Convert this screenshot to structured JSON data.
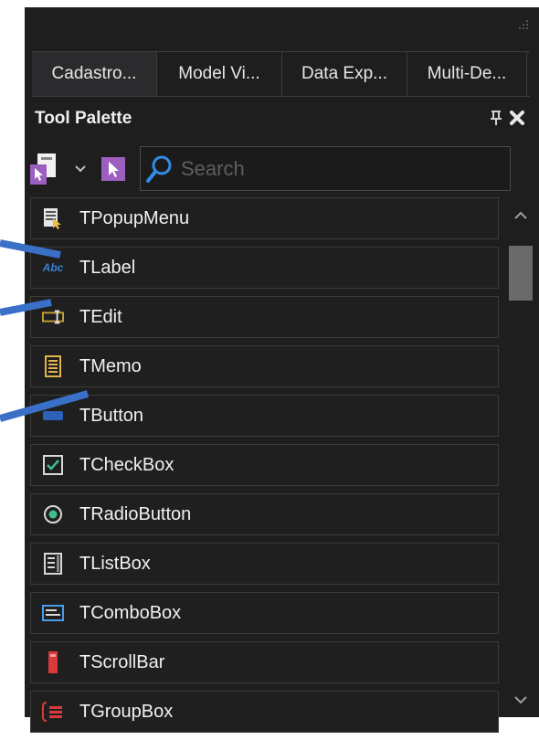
{
  "tabs": [
    "Cadastro...",
    "Model Vi...",
    "Data Exp...",
    "Multi-De..."
  ],
  "palette": {
    "title": "Tool Palette",
    "search_placeholder": "Search"
  },
  "items": [
    {
      "label": "TPopupMenu",
      "icon": "popup-menu-icon"
    },
    {
      "label": "TLabel",
      "icon": "label-icon",
      "icon_text": "Abc"
    },
    {
      "label": "TEdit",
      "icon": "edit-icon"
    },
    {
      "label": "TMemo",
      "icon": "memo-icon"
    },
    {
      "label": "TButton",
      "icon": "button-icon"
    },
    {
      "label": "TCheckBox",
      "icon": "checkbox-icon"
    },
    {
      "label": "TRadioButton",
      "icon": "radio-button-icon"
    },
    {
      "label": "TListBox",
      "icon": "listbox-icon"
    },
    {
      "label": "TComboBox",
      "icon": "combobox-icon"
    },
    {
      "label": "TScrollBar",
      "icon": "scrollbar-icon"
    },
    {
      "label": "TGroupBox",
      "icon": "groupbox-icon"
    }
  ],
  "colors": {
    "background": "#1e1e1f",
    "annotation_line": "#3a70c8",
    "text": "#f0f0f0"
  }
}
